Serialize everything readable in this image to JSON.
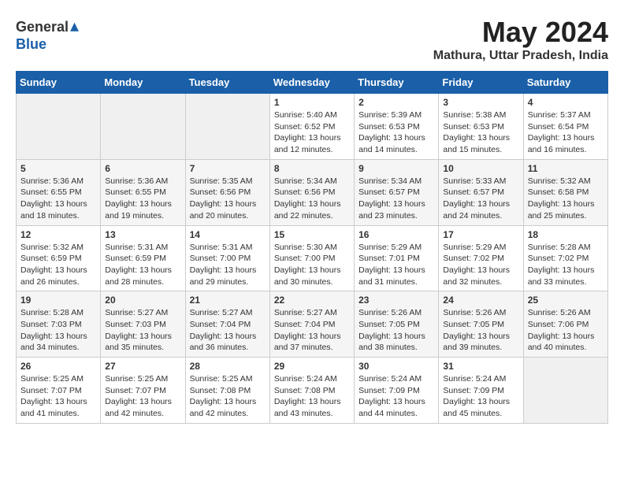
{
  "header": {
    "logo": {
      "general": "General",
      "blue": "Blue"
    },
    "title": "May 2024",
    "subtitle": "Mathura, Uttar Pradesh, India"
  },
  "calendar": {
    "days_of_week": [
      "Sunday",
      "Monday",
      "Tuesday",
      "Wednesday",
      "Thursday",
      "Friday",
      "Saturday"
    ],
    "weeks": [
      {
        "days": [
          {
            "date": "",
            "info": ""
          },
          {
            "date": "",
            "info": ""
          },
          {
            "date": "",
            "info": ""
          },
          {
            "date": "1",
            "info": "Sunrise: 5:40 AM\nSunset: 6:52 PM\nDaylight: 13 hours and 12 minutes."
          },
          {
            "date": "2",
            "info": "Sunrise: 5:39 AM\nSunset: 6:53 PM\nDaylight: 13 hours and 14 minutes."
          },
          {
            "date": "3",
            "info": "Sunrise: 5:38 AM\nSunset: 6:53 PM\nDaylight: 13 hours and 15 minutes."
          },
          {
            "date": "4",
            "info": "Sunrise: 5:37 AM\nSunset: 6:54 PM\nDaylight: 13 hours and 16 minutes."
          }
        ]
      },
      {
        "days": [
          {
            "date": "5",
            "info": "Sunrise: 5:36 AM\nSunset: 6:55 PM\nDaylight: 13 hours and 18 minutes."
          },
          {
            "date": "6",
            "info": "Sunrise: 5:36 AM\nSunset: 6:55 PM\nDaylight: 13 hours and 19 minutes."
          },
          {
            "date": "7",
            "info": "Sunrise: 5:35 AM\nSunset: 6:56 PM\nDaylight: 13 hours and 20 minutes."
          },
          {
            "date": "8",
            "info": "Sunrise: 5:34 AM\nSunset: 6:56 PM\nDaylight: 13 hours and 22 minutes."
          },
          {
            "date": "9",
            "info": "Sunrise: 5:34 AM\nSunset: 6:57 PM\nDaylight: 13 hours and 23 minutes."
          },
          {
            "date": "10",
            "info": "Sunrise: 5:33 AM\nSunset: 6:57 PM\nDaylight: 13 hours and 24 minutes."
          },
          {
            "date": "11",
            "info": "Sunrise: 5:32 AM\nSunset: 6:58 PM\nDaylight: 13 hours and 25 minutes."
          }
        ]
      },
      {
        "days": [
          {
            "date": "12",
            "info": "Sunrise: 5:32 AM\nSunset: 6:59 PM\nDaylight: 13 hours and 26 minutes."
          },
          {
            "date": "13",
            "info": "Sunrise: 5:31 AM\nSunset: 6:59 PM\nDaylight: 13 hours and 28 minutes."
          },
          {
            "date": "14",
            "info": "Sunrise: 5:31 AM\nSunset: 7:00 PM\nDaylight: 13 hours and 29 minutes."
          },
          {
            "date": "15",
            "info": "Sunrise: 5:30 AM\nSunset: 7:00 PM\nDaylight: 13 hours and 30 minutes."
          },
          {
            "date": "16",
            "info": "Sunrise: 5:29 AM\nSunset: 7:01 PM\nDaylight: 13 hours and 31 minutes."
          },
          {
            "date": "17",
            "info": "Sunrise: 5:29 AM\nSunset: 7:02 PM\nDaylight: 13 hours and 32 minutes."
          },
          {
            "date": "18",
            "info": "Sunrise: 5:28 AM\nSunset: 7:02 PM\nDaylight: 13 hours and 33 minutes."
          }
        ]
      },
      {
        "days": [
          {
            "date": "19",
            "info": "Sunrise: 5:28 AM\nSunset: 7:03 PM\nDaylight: 13 hours and 34 minutes."
          },
          {
            "date": "20",
            "info": "Sunrise: 5:27 AM\nSunset: 7:03 PM\nDaylight: 13 hours and 35 minutes."
          },
          {
            "date": "21",
            "info": "Sunrise: 5:27 AM\nSunset: 7:04 PM\nDaylight: 13 hours and 36 minutes."
          },
          {
            "date": "22",
            "info": "Sunrise: 5:27 AM\nSunset: 7:04 PM\nDaylight: 13 hours and 37 minutes."
          },
          {
            "date": "23",
            "info": "Sunrise: 5:26 AM\nSunset: 7:05 PM\nDaylight: 13 hours and 38 minutes."
          },
          {
            "date": "24",
            "info": "Sunrise: 5:26 AM\nSunset: 7:05 PM\nDaylight: 13 hours and 39 minutes."
          },
          {
            "date": "25",
            "info": "Sunrise: 5:26 AM\nSunset: 7:06 PM\nDaylight: 13 hours and 40 minutes."
          }
        ]
      },
      {
        "days": [
          {
            "date": "26",
            "info": "Sunrise: 5:25 AM\nSunset: 7:07 PM\nDaylight: 13 hours and 41 minutes."
          },
          {
            "date": "27",
            "info": "Sunrise: 5:25 AM\nSunset: 7:07 PM\nDaylight: 13 hours and 42 minutes."
          },
          {
            "date": "28",
            "info": "Sunrise: 5:25 AM\nSunset: 7:08 PM\nDaylight: 13 hours and 42 minutes."
          },
          {
            "date": "29",
            "info": "Sunrise: 5:24 AM\nSunset: 7:08 PM\nDaylight: 13 hours and 43 minutes."
          },
          {
            "date": "30",
            "info": "Sunrise: 5:24 AM\nSunset: 7:09 PM\nDaylight: 13 hours and 44 minutes."
          },
          {
            "date": "31",
            "info": "Sunrise: 5:24 AM\nSunset: 7:09 PM\nDaylight: 13 hours and 45 minutes."
          },
          {
            "date": "",
            "info": ""
          }
        ]
      }
    ]
  }
}
